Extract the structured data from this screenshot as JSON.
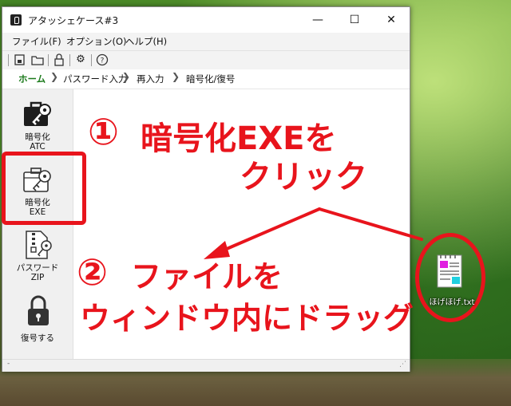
{
  "window": {
    "title": "アタッシェケース#3",
    "controls": {
      "minimize": "—",
      "maximize": "☐",
      "close": "✕"
    }
  },
  "menu": [
    "ファイル(F)",
    "オプション(O)",
    "ヘルプ(H)"
  ],
  "breadcrumb": [
    "ホーム",
    "パスワード入力",
    "再入力",
    "暗号化/復号"
  ],
  "sidebar": {
    "items": [
      {
        "label_line1": "暗号化",
        "label_line2": "ATC",
        "icon": "briefcase-key-icon"
      },
      {
        "label_line1": "暗号化",
        "label_line2": "EXE",
        "icon": "exe-key-icon"
      },
      {
        "label_line1": "パスワード",
        "label_line2": "ZIP",
        "icon": "zip-key-icon"
      },
      {
        "label_line1": "復号する",
        "label_line2": "",
        "icon": "padlock-icon"
      }
    ]
  },
  "annotations": {
    "step1_number": "①",
    "step1_line1": "暗号化EXEを",
    "step1_line2": "クリック",
    "step2_number": "②",
    "step2_line1": "ファイルを",
    "step2_line2": "ウィンドウ内にドラッグ"
  },
  "desktop_file": {
    "name": "ほげほげ.txt",
    "icon": "text-file-icon"
  },
  "colors": {
    "annotation_red": "#e8141c",
    "breadcrumb_active": "#1b7a1b"
  }
}
